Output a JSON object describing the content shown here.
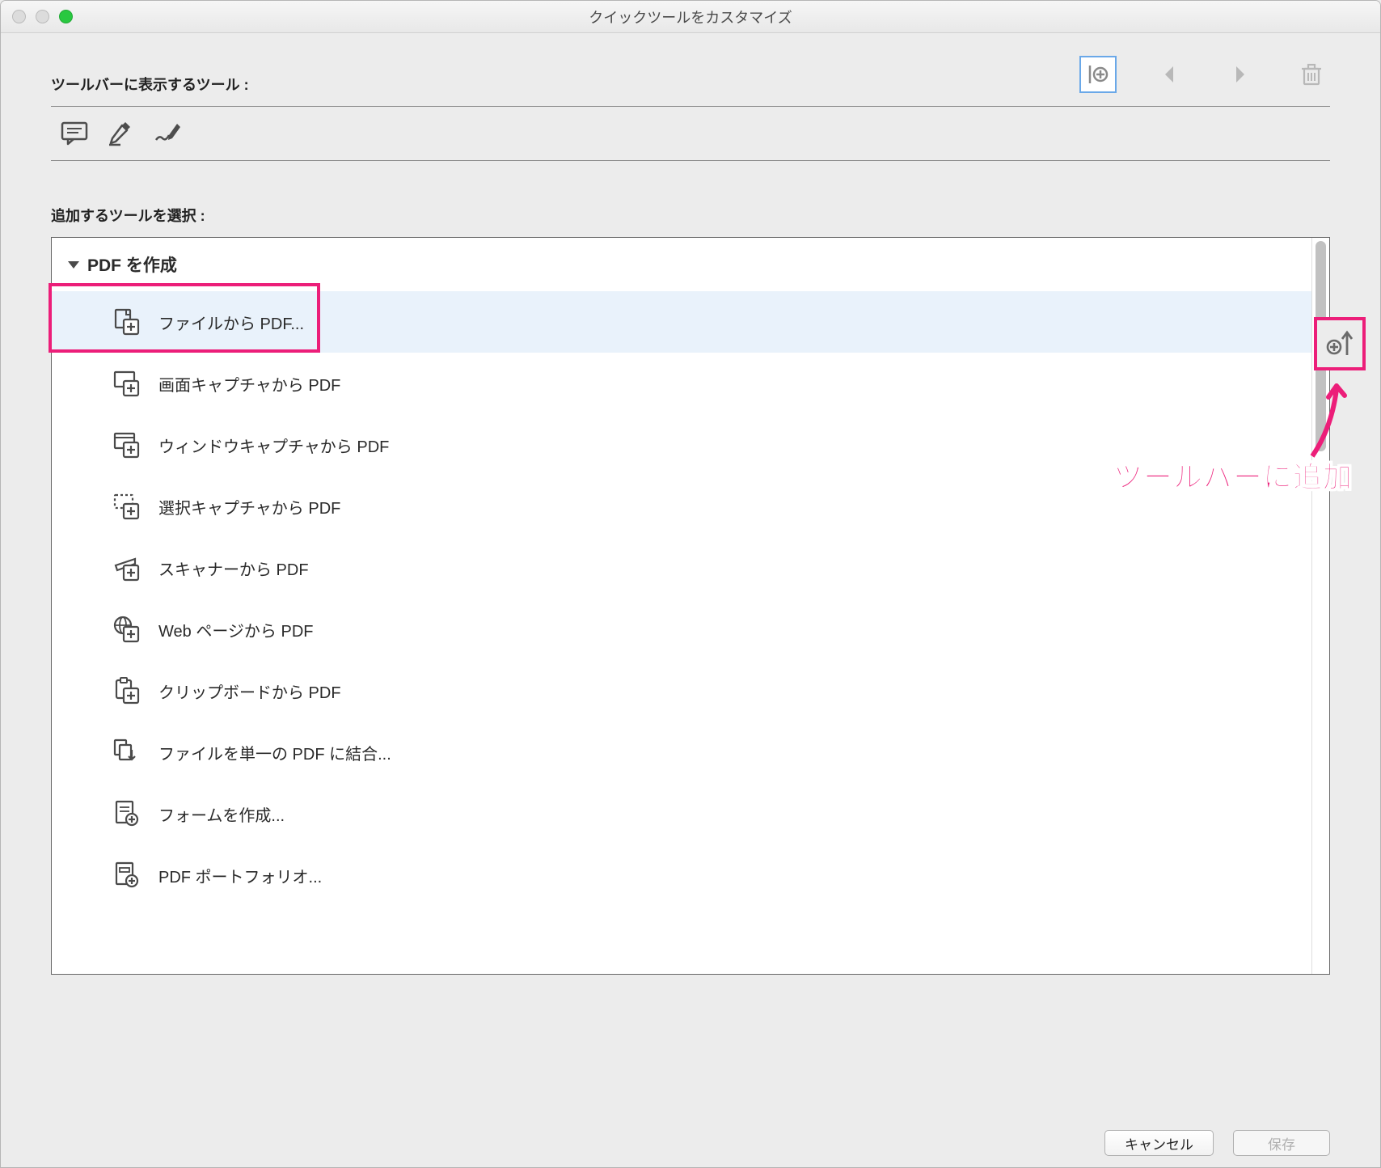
{
  "window": {
    "title": "クイックツールをカスタマイズ"
  },
  "sections": {
    "toolbar_label": "ツールバーに表示するツール :",
    "choose_label": "追加するツールを選択 :"
  },
  "tool_group": {
    "title": "PDF を作成",
    "items": [
      {
        "label": "ファイルから PDF...",
        "icon": "page-plus"
      },
      {
        "label": "画面キャプチャから PDF",
        "icon": "screen-capture"
      },
      {
        "label": "ウィンドウキャプチャから PDF",
        "icon": "window-capture"
      },
      {
        "label": "選択キャプチャから PDF",
        "icon": "selection-capture"
      },
      {
        "label": "スキャナーから PDF",
        "icon": "scanner"
      },
      {
        "label": "Web ページから PDF",
        "icon": "web-page"
      },
      {
        "label": "クリップボードから PDF",
        "icon": "clipboard"
      },
      {
        "label": "ファイルを単一の PDF に結合...",
        "icon": "combine"
      },
      {
        "label": "フォームを作成...",
        "icon": "form"
      },
      {
        "label": "PDF ポートフォリオ...",
        "icon": "portfolio"
      }
    ]
  },
  "annotation": {
    "label": "ツールバーに追加"
  },
  "footer": {
    "cancel": "キャンセル",
    "save": "保存"
  }
}
